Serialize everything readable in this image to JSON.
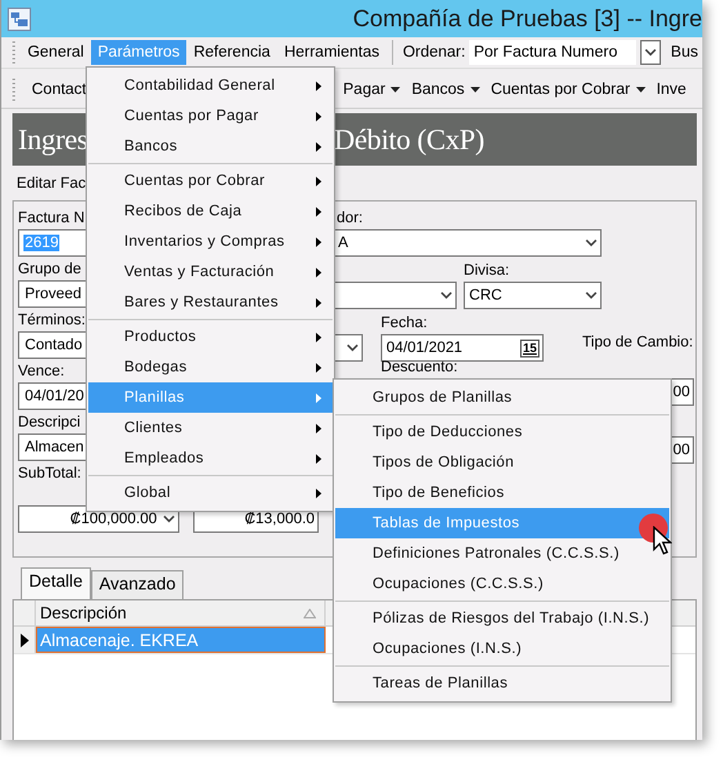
{
  "window": {
    "title": "Compañía de Pruebas [3] -- Ingre"
  },
  "menu_bar": {
    "items": [
      {
        "label": "General",
        "selected": false
      },
      {
        "label": "Parámetros",
        "selected": true
      },
      {
        "label": "Referencia",
        "selected": false
      },
      {
        "label": "Herramientas",
        "selected": false
      }
    ],
    "sort_label": "Ordenar:",
    "sort_value": "Por Factura Numero",
    "search_label": "Bus"
  },
  "toolbar": {
    "items": [
      {
        "label": "Contact",
        "dropdown": false
      },
      {
        "label": "Pagar",
        "dropdown": true
      },
      {
        "label": "Bancos",
        "dropdown": true
      },
      {
        "label": "Cuentas por Cobrar",
        "dropdown": true
      },
      {
        "label": "Inve",
        "dropdown": false
      }
    ]
  },
  "header": {
    "title_start": "Ingres",
    "title_end": "Débito (CxP)"
  },
  "form_tab": "Editar Fac",
  "form": {
    "left_fields": [
      {
        "label": "Factura N",
        "value": "2619",
        "highlighted": true
      },
      {
        "label": "Grupo de",
        "value": "Proveed",
        "highlighted": false
      },
      {
        "label": "Términos:",
        "value": "Contado",
        "highlighted": false
      },
      {
        "label": "Vence:",
        "value": "04/01/20",
        "highlighted": false
      },
      {
        "label": "Descripci",
        "value": "Almacen",
        "highlighted": false
      }
    ],
    "subtotal": {
      "label": "SubTotal:",
      "amounts": [
        {
          "value": "₡100,000.00",
          "dropdown": true
        },
        {
          "value": "₡13,000.0",
          "dropdown": false
        }
      ]
    },
    "supplier": {
      "label": "dor:",
      "value": "A"
    },
    "currency": {
      "label": "Divisa:",
      "value": "CRC"
    },
    "date": {
      "label": "Fecha:",
      "value": "04/01/2021",
      "calendar_day": "15"
    },
    "exchange_rate_label": "Tipo de Cambio:",
    "discount": {
      "label": "Descuento:",
      "value": "00"
    },
    "amount_value": "00"
  },
  "detail_tabs": [
    {
      "label": "Detalle",
      "selected": true
    },
    {
      "label": "Avanzado",
      "selected": false
    }
  ],
  "table": {
    "columns": [
      "Descripción"
    ],
    "rows": [
      {
        "cells": [
          "Almacenaje. EKREA"
        ],
        "selected": true
      }
    ]
  },
  "menu": {
    "items": [
      {
        "kind": "item",
        "label": "Contabilidad General",
        "selected": false,
        "submenu": true
      },
      {
        "kind": "item",
        "label": "Cuentas por Pagar",
        "selected": false,
        "submenu": true
      },
      {
        "kind": "item",
        "label": "Bancos",
        "selected": false,
        "submenu": true
      },
      {
        "kind": "separator"
      },
      {
        "kind": "item",
        "label": "Cuentas por Cobrar",
        "selected": false,
        "submenu": true
      },
      {
        "kind": "item",
        "label": "Recibos de Caja",
        "selected": false,
        "submenu": true
      },
      {
        "kind": "item",
        "label": "Inventarios y Compras",
        "selected": false,
        "submenu": true
      },
      {
        "kind": "item",
        "label": "Ventas y Facturación",
        "selected": false,
        "submenu": true
      },
      {
        "kind": "item",
        "label": "Bares y Restaurantes",
        "selected": false,
        "submenu": true
      },
      {
        "kind": "separator"
      },
      {
        "kind": "item",
        "label": "Productos",
        "selected": false,
        "submenu": true
      },
      {
        "kind": "item",
        "label": "Bodegas",
        "selected": false,
        "submenu": true
      },
      {
        "kind": "item",
        "label": "Planillas",
        "selected": true,
        "submenu": true
      },
      {
        "kind": "item",
        "label": "Clientes",
        "selected": false,
        "submenu": true
      },
      {
        "kind": "item",
        "label": "Empleados",
        "selected": false,
        "submenu": true
      },
      {
        "kind": "separator"
      },
      {
        "kind": "item",
        "label": "Global",
        "selected": false,
        "submenu": true
      }
    ]
  },
  "submenu": {
    "items": [
      {
        "kind": "item",
        "label": "Grupos de Planillas",
        "selected": false
      },
      {
        "kind": "separator"
      },
      {
        "kind": "item",
        "label": "Tipo de Deducciones",
        "selected": false
      },
      {
        "kind": "item",
        "label": "Tipos de Obligación",
        "selected": false
      },
      {
        "kind": "item",
        "label": "Tipo de Beneficios",
        "selected": false
      },
      {
        "kind": "item",
        "label": "Tablas de Impuestos",
        "selected": true
      },
      {
        "kind": "item",
        "label": "Definiciones Patronales (C.C.S.S.)",
        "selected": false
      },
      {
        "kind": "item",
        "label": "Ocupaciones (C.C.S.S.)",
        "selected": false
      },
      {
        "kind": "separator"
      },
      {
        "kind": "item",
        "label": "Pólizas de Riesgos del Trabajo (I.N.S.)",
        "selected": false
      },
      {
        "kind": "item",
        "label": "Ocupaciones (I.N.S.)",
        "selected": false
      },
      {
        "kind": "separator"
      },
      {
        "kind": "item",
        "label": "Tareas de Planillas",
        "selected": false
      }
    ]
  }
}
